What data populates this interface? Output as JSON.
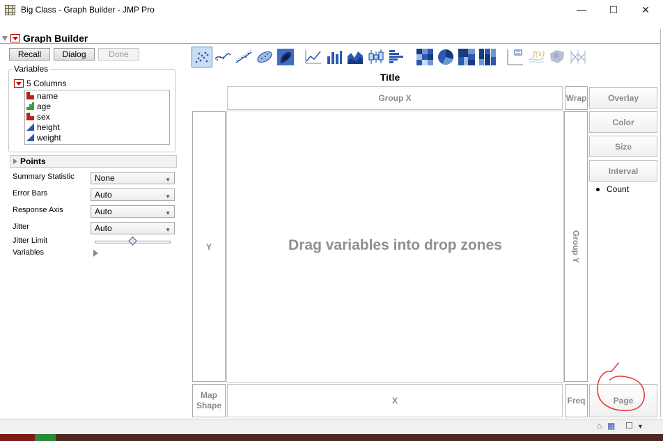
{
  "window": {
    "title": "Big Class - Graph Builder - JMP Pro",
    "minimize": "—",
    "maximize": "☐",
    "close": "✕"
  },
  "graph_builder": {
    "title": "Graph Builder",
    "recall_label": "Recall",
    "dialog_label": "Dialog",
    "done_label": "Done"
  },
  "variables": {
    "group_label": "Variables",
    "columns_label": "5 Columns",
    "columns": [
      {
        "name": "name",
        "type": "nominal"
      },
      {
        "name": "age",
        "type": "ordinal"
      },
      {
        "name": "sex",
        "type": "nominal"
      },
      {
        "name": "height",
        "type": "continuous"
      },
      {
        "name": "weight",
        "type": "continuous"
      }
    ]
  },
  "points": {
    "header": "Points",
    "summary_statistic_label": "Summary Statistic",
    "summary_statistic_value": "None",
    "error_bars_label": "Error Bars",
    "error_bars_value": "Auto",
    "response_axis_label": "Response Axis",
    "response_axis_value": "Auto",
    "jitter_label": "Jitter",
    "jitter_value": "Auto",
    "jitter_limit_label": "Jitter Limit",
    "jitter_limit_level": 0.5,
    "variables_label": "Variables"
  },
  "toolbar": {
    "selected": "points",
    "tools": [
      "points",
      "smoother",
      "line-of-fit",
      "ellipse",
      "contour",
      "line",
      "bar",
      "area",
      "box-plot",
      "histogram",
      "heatmap",
      "pie",
      "treemap",
      "mosaic",
      "caption-box",
      "formula",
      "map-shapes",
      "parallel-axes"
    ]
  },
  "graph": {
    "title": "Title",
    "group_x": "Group X",
    "wrap": "Wrap",
    "y": "Y",
    "group_y": "Group Y",
    "x": "X",
    "freq": "Freq",
    "map_shape": "Map Shape",
    "drop_message": "Drag variables into drop zones"
  },
  "right_panel": {
    "overlay": "Overlay",
    "color": "Color",
    "size": "Size",
    "interval": "Interval",
    "count": "Count",
    "page": "Page"
  },
  "colors": {
    "accent": "#4f7fb8",
    "nominal_icon": "#b5261b",
    "ordinal_icon": "#3c9b3c",
    "continuous_icon": "#2b59b3",
    "annotation": "#e53a3a"
  }
}
